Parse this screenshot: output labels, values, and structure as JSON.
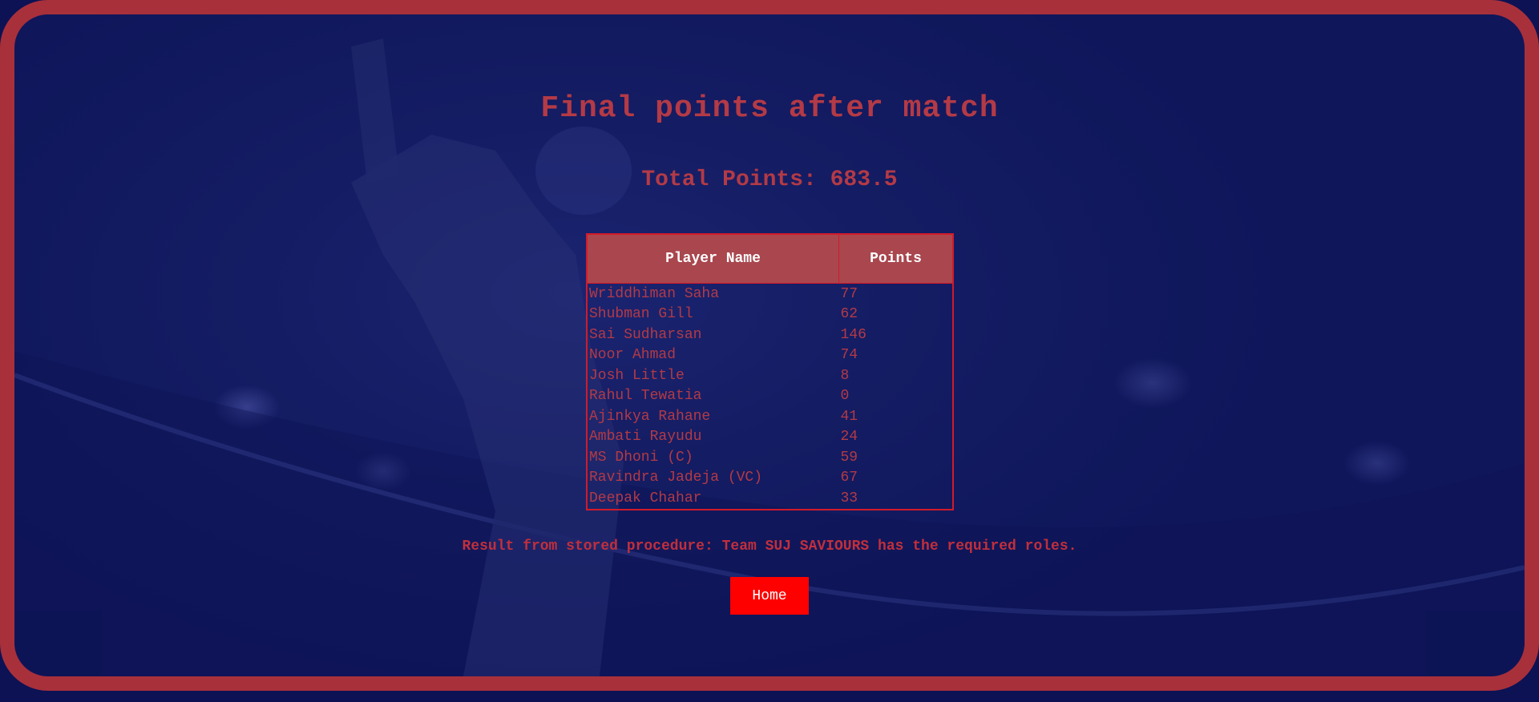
{
  "page": {
    "title": "Final points after match",
    "total_points_label": "Total Points: 683.5"
  },
  "table": {
    "headers": {
      "player": "Player Name",
      "points": "Points"
    },
    "rows": [
      {
        "player": "Wriddhiman Saha",
        "points": "77"
      },
      {
        "player": "Shubman Gill",
        "points": "62"
      },
      {
        "player": "Sai Sudharsan",
        "points": "146"
      },
      {
        "player": "Noor Ahmad",
        "points": "74"
      },
      {
        "player": "Josh Little",
        "points": "8"
      },
      {
        "player": "Rahul Tewatia",
        "points": "0"
      },
      {
        "player": "Ajinkya Rahane",
        "points": "41"
      },
      {
        "player": "Ambati Rayudu",
        "points": "24"
      },
      {
        "player": "MS Dhoni (C)",
        "points": "59"
      },
      {
        "player": "Ravindra Jadeja (VC)",
        "points": "67"
      },
      {
        "player": "Deepak Chahar",
        "points": "33"
      }
    ]
  },
  "result_message": "Result from stored procedure: Team SUJ SAVIOURS has the required roles.",
  "home_button_label": "Home",
  "colors": {
    "frame_border": "#a8303b",
    "background": "#141c63",
    "text_accent": "#b33a46",
    "table_header_bg": "#a9464e",
    "table_border": "#d21a2a",
    "button_bg": "#ff0000",
    "button_text": "#ffffff"
  }
}
